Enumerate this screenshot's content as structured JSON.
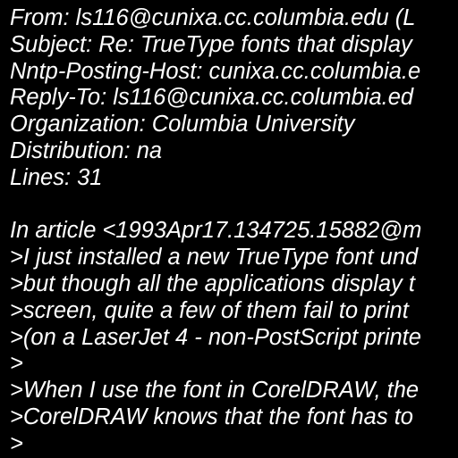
{
  "message": {
    "lines": [
      "From: ls116@cunixa.cc.columbia.edu (L",
      "Subject: Re: TrueType fonts that display",
      "Nntp-Posting-Host: cunixa.cc.columbia.e",
      "Reply-To: ls116@cunixa.cc.columbia.ed",
      "Organization: Columbia University",
      "Distribution: na",
      "Lines: 31",
      "",
      "In article <1993Apr17.134725.15882@m",
      ">I just installed a new TrueType font und",
      ">but though all the applications display t",
      ">screen, quite a few of them fail to print",
      ">(on a LaserJet 4 - non-PostScript printe",
      ">",
      ">When I use the font in CorelDRAW, the",
      ">CorelDRAW knows that the font has to",
      ">"
    ]
  },
  "colors": {
    "background": "#000000",
    "text": "#ffffff"
  }
}
